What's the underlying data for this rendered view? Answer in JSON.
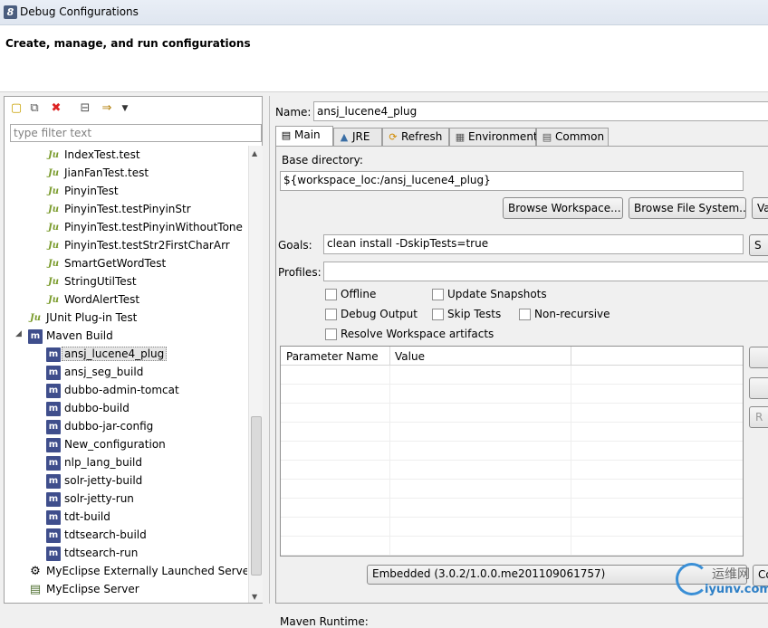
{
  "window": {
    "title": "Debug Configurations",
    "app_icon": "eclipse-logo-icon"
  },
  "header": {
    "subtitle": "Create, manage, and run configurations"
  },
  "left": {
    "toolbar": [
      "new-config-icon",
      "duplicate-icon",
      "delete-icon",
      "collapse-all-icon",
      "filter-icon",
      "dropdown-icon"
    ],
    "filter_placeholder": "type filter text",
    "tree": [
      {
        "label": "IndexTest.test",
        "icon": "junit-icon",
        "level": 2
      },
      {
        "label": "JianFanTest.test",
        "icon": "junit-icon",
        "level": 2
      },
      {
        "label": "PinyinTest",
        "icon": "junit-icon",
        "level": 2
      },
      {
        "label": "PinyinTest.testPinyinStr",
        "icon": "junit-icon",
        "level": 2
      },
      {
        "label": "PinyinTest.testPinyinWithoutTone",
        "icon": "junit-icon",
        "level": 2
      },
      {
        "label": "PinyinTest.testStr2FirstCharArr",
        "icon": "junit-icon",
        "level": 2
      },
      {
        "label": "SmartGetWordTest",
        "icon": "junit-icon",
        "level": 2
      },
      {
        "label": "StringUtilTest",
        "icon": "junit-icon",
        "level": 2
      },
      {
        "label": "WordAlertTest",
        "icon": "junit-icon",
        "level": 2
      },
      {
        "label": "JUnit Plug-in Test",
        "icon": "junit-plugin-icon",
        "level": 1
      },
      {
        "label": "Maven Build",
        "icon": "maven-icon",
        "level": 1,
        "expanded": true
      },
      {
        "label": "ansj_lucene4_plug",
        "icon": "maven-icon",
        "level": 2,
        "selected": true
      },
      {
        "label": "ansj_seg_build",
        "icon": "maven-icon",
        "level": 2
      },
      {
        "label": "dubbo-admin-tomcat",
        "icon": "maven-icon",
        "level": 2
      },
      {
        "label": "dubbo-build",
        "icon": "maven-icon",
        "level": 2
      },
      {
        "label": "dubbo-jar-config",
        "icon": "maven-icon",
        "level": 2
      },
      {
        "label": "New_configuration",
        "icon": "maven-icon",
        "level": 2
      },
      {
        "label": "nlp_lang_build",
        "icon": "maven-icon",
        "level": 2
      },
      {
        "label": "solr-jetty-build",
        "icon": "maven-icon",
        "level": 2
      },
      {
        "label": "solr-jetty-run",
        "icon": "maven-icon",
        "level": 2
      },
      {
        "label": "tdt-build",
        "icon": "maven-icon",
        "level": 2
      },
      {
        "label": "tdtsearch-build",
        "icon": "maven-icon",
        "level": 2
      },
      {
        "label": "tdtsearch-run",
        "icon": "maven-icon",
        "level": 2
      },
      {
        "label": "MyEclipse Externally Launched Server",
        "icon": "server-external-icon",
        "level": 1
      },
      {
        "label": "MyEclipse Server",
        "icon": "server-icon",
        "level": 1
      }
    ]
  },
  "right": {
    "name_label": "Name:",
    "name_value": "ansj_lucene4_plug",
    "tabs": [
      {
        "label": "Main",
        "icon": "main-tab-icon",
        "active": true
      },
      {
        "label": "JRE",
        "icon": "jre-icon"
      },
      {
        "label": "Refresh",
        "icon": "refresh-icon"
      },
      {
        "label": "Environment",
        "icon": "environment-icon"
      },
      {
        "label": "Common",
        "icon": "common-icon"
      }
    ],
    "base_dir_label": "Base directory:",
    "base_dir_value": "${workspace_loc:/ansj_lucene4_plug}",
    "browse_workspace": "Browse Workspace...",
    "browse_fs": "Browse File System...",
    "variables_btn": "Va",
    "goals_label": "Goals:",
    "goals_value": "clean install -DskipTests=true",
    "goals_side_btn": "S",
    "profiles_label": "Profiles:",
    "profiles_value": "",
    "checkboxes": {
      "offline": "Offline",
      "update_snapshots": "Update Snapshots",
      "debug_output": "Debug Output",
      "skip_tests": "Skip Tests",
      "non_recursive": "Non-recursive",
      "resolve_workspace": "Resolve Workspace artifacts"
    },
    "table": {
      "col_name": "Parameter Name",
      "col_value": "Value"
    },
    "side_buttons": [
      "",
      "",
      "R"
    ],
    "runtime_label": "Maven Runtime:",
    "runtime_value": "Embedded (3.0.2/1.0.0.me201109061757)",
    "runtime_side_btn": "Co"
  },
  "watermark": {
    "line1": "运维网",
    "line2": "iyunv.com"
  }
}
